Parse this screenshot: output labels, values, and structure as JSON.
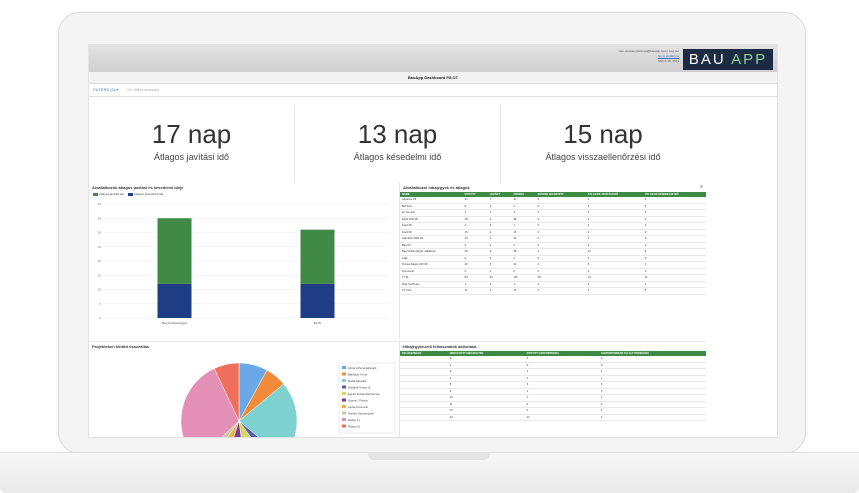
{
  "header": {
    "user_line": "Hon-teresa-nyilvanos@bauapp.com | Log out",
    "link_line": "Go to webforms",
    "date_line": "March 15, 2021",
    "logo_left": "BAU",
    "logo_right": "APP",
    "page_title": "BauApp Dashboard PILOT"
  },
  "filters": {
    "label": "FILTERS (0) ▾",
    "hint": "No filters selected"
  },
  "kpis": [
    {
      "value": "17 nap",
      "label": "Átlagos javítási idő"
    },
    {
      "value": "13 nap",
      "label": "Átlagos késedelmi idő"
    },
    {
      "value": "15 nap",
      "label": "Átlagos visszaellenőrzési idő"
    }
  ],
  "bar_panel": {
    "title": "Alvállalkozók átlagos javítási és késedelmi ideje",
    "legend": [
      "Átlagos javítási idő",
      "Átlagos késedelmi idő"
    ],
    "colors": {
      "javitasi": "#3f8b45",
      "kesedelmi": "#1f3d85"
    }
  },
  "chart_data": [
    {
      "type": "bar",
      "stacked": true,
      "categories": [
        "Bau Kivitelezőgyár",
        "ÉF Bt"
      ],
      "series": [
        {
          "name": "Átlagos késedelmi idő",
          "values": [
            12,
            12
          ]
        },
        {
          "name": "Átlagos javítási idő",
          "values": [
            23,
            19
          ]
        }
      ],
      "ylim": [
        0,
        40
      ],
      "yticks": [
        0,
        5,
        10,
        15,
        20,
        25,
        30,
        35,
        40
      ]
    },
    {
      "type": "pie",
      "title": "Projekteken költött összeállás",
      "labels": [
        "Almai otthona lakópark",
        "Bauhaus Trend",
        "Budai lakópark",
        "Budafok Terasz III",
        "Egyéb Kiviteli Rezidencia",
        "Gázmű / Palace",
        "Lavde Dimenzió",
        "Pomázi Kerttelepítés",
        "Ráday 11",
        "Ráday 15"
      ],
      "values": [
        8,
        6,
        22,
        4,
        8,
        7,
        5,
        3,
        30,
        7
      ]
    }
  ],
  "contractor_table": {
    "title": "Alvállalkozói hibajegyek és átlagok",
    "columns": [
      "NAME",
      "NYITOTT",
      "LEZÁRT",
      "ÖSSZES",
      "KÉSZRE JELENTETT",
      "ÁTLAGOS JAVÍTÁSI IDŐ",
      "ÁTLAGOS KÉSEDELMI IDŐ"
    ],
    "rows": [
      [
        "Aquarius Kft.",
        "24",
        "7",
        "31",
        "0",
        "0",
        "0"
      ],
      [
        "BeThere",
        "0",
        "0",
        "0",
        "0",
        "0",
        "0"
      ],
      [
        "El. nemesít",
        "2",
        "1",
        "3",
        "0",
        "0",
        "0"
      ],
      [
        "Építő 2010 Bt",
        "38",
        "2",
        "38",
        "0",
        "0",
        "0"
      ],
      [
        "Festő Bt",
        "2",
        "0",
        "2",
        "0",
        "0",
        "0"
      ],
      [
        "Festő Bt",
        "15",
        "0",
        "15",
        "0",
        "0",
        "0"
      ],
      [
        "GlasTech 2000 Kft",
        "16",
        "4",
        "20",
        "0",
        "0",
        "0"
      ],
      [
        "Bau Kft",
        "0",
        "0",
        "0",
        "0",
        "0",
        "0"
      ],
      [
        "Bau Kivitelezőgyár vállalkozó",
        "49",
        "6",
        "55",
        "2",
        "10",
        "4"
      ],
      [
        "Lakk",
        "0",
        "0",
        "0",
        "0",
        "0",
        "0"
      ],
      [
        "Tornas Zaketo 220 Kft",
        "29",
        "3",
        "32",
        "0",
        "0",
        "0"
      ],
      [
        "Termosolo",
        "0",
        "0",
        "0",
        "0",
        "0",
        "0"
      ],
      [
        "TT Bt",
        "83",
        "33",
        "116",
        "28",
        "13",
        "11"
      ],
      [
        "Warr Glo/Trans",
        "1",
        "0",
        "1",
        "0",
        "0",
        "0"
      ],
      [
        "XY Kcht",
        "11",
        "2",
        "13",
        "0",
        "0",
        "0"
      ]
    ]
  },
  "activity_table": {
    "title": "Hibajegykezelő felhasználók aktivitása",
    "columns": [
      "FELHASZNÁLÓ",
      "BEKÜLDÖTT HIBAJEGYEK",
      "NYITOTT CSOPORTOKBA",
      "CSOPORTOKBAN TALÁLT PROBLÉMA"
    ],
    "rows": [
      [
        "",
        "1",
        "0",
        "0"
      ],
      [
        "",
        "2",
        "0",
        "0"
      ],
      [
        "",
        "2",
        "1",
        "1"
      ],
      [
        "",
        "2",
        "2",
        "1"
      ],
      [
        "",
        "5",
        "0",
        "0"
      ],
      [
        "",
        "5",
        "1",
        "0"
      ],
      [
        "",
        "10",
        "1",
        "1"
      ],
      [
        "",
        "11",
        "0",
        "0"
      ],
      [
        "",
        "13",
        "4",
        "7"
      ],
      [
        "",
        "20",
        "13",
        "3"
      ]
    ]
  }
}
